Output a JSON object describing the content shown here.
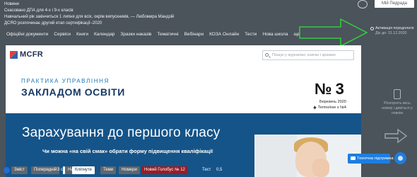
{
  "news": {
    "items": [
      "Новини",
      "Скасовано ДПА для 4-х і 9-х класів",
      "Навчальний рік закінчиться 1 липня для всіх, окрім випускників, — Любомира Мандзій",
      "ДСЯО розпочинає другий етап сертифікації–2020"
    ]
  },
  "header": {
    "login_label": "Мій Педрада"
  },
  "nav": {
    "items": [
      "Офіційні документи",
      "Сервіси",
      "Книги",
      "Календар",
      "Зразки наказів",
      "Тематичні",
      "Вебінари",
      "КОЗА Онлайн",
      "Тести",
      "Нова школа",
      "ще"
    ]
  },
  "activation": {
    "title": "Активація передплати",
    "subtitle": "Діє до: 31.12.2020"
  },
  "viewer": {
    "logo_text": "MCFR",
    "search_placeholder": "Пошук у журналах, книгах і зразках",
    "mag_subtitle": "ПРАКТИКА УПРАВЛІННЯ",
    "mag_title": "ЗАКЛАДОМ ОСВІТИ",
    "issue_number": "№ 3",
    "issue_date": "Березень 2020",
    "issue_next": "Terms/ese з №4",
    "banner_title": "Зарахування до першого класу",
    "banner_subtitle": "Чи можна «на свій смак» обрати форму підвищення кваліфікації"
  },
  "side": {
    "message": "Розгорніть весь номер і дивіться у повнім"
  },
  "toolbar": {
    "items": [
      "Зміст",
      "Попередній",
      "3 с",
      "Наступна",
      "Кліпнуте",
      "Теми",
      "Номери",
      "Новий Голобус № 12",
      "Тест",
      "0,5"
    ]
  },
  "support": {
    "label": "Технічна підтримка"
  },
  "colors": {
    "accent_green": "#33c940",
    "banner_blue": "#155489",
    "support_blue": "#1d7ee0",
    "red": "#9b1c22"
  }
}
